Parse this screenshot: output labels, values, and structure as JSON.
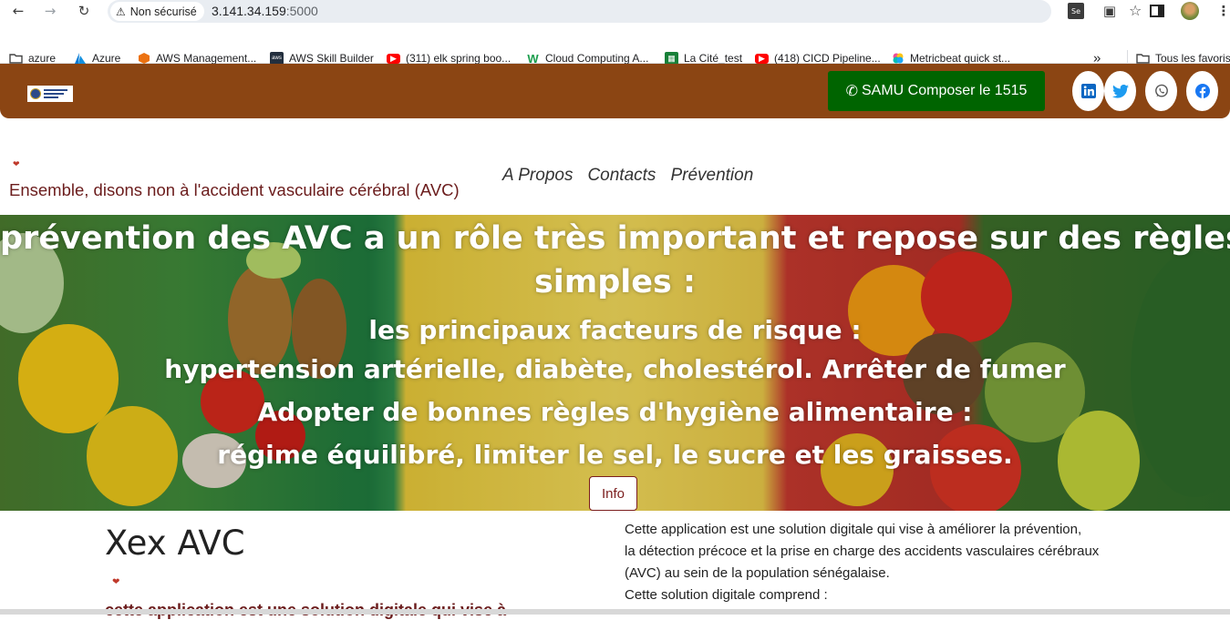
{
  "browser": {
    "security_label": "Non sécurisé",
    "url_host": "3.141.34.159",
    "url_port": ":5000",
    "bookmarks": [
      {
        "label": "azure",
        "icon": "folder-icon"
      },
      {
        "label": "Azure",
        "icon": "azure-icon"
      },
      {
        "label": "AWS Management...",
        "icon": "aws-cube-icon"
      },
      {
        "label": "AWS Skill Builder",
        "icon": "aws-icon"
      },
      {
        "label": "(311) elk spring boo...",
        "icon": "youtube-icon"
      },
      {
        "label": "Cloud Computing A...",
        "icon": "w-icon"
      },
      {
        "label": "La Cité_test",
        "icon": "sheet-icon"
      },
      {
        "label": "(418) CICD Pipeline...",
        "icon": "youtube-icon"
      },
      {
        "label": "Metricbeat quick st...",
        "icon": "elastic-icon"
      }
    ],
    "overflow_label": "»",
    "all_bookmarks_label": "Tous les favoris"
  },
  "header": {
    "samu_label": "SAMU Composer le 1515",
    "social": [
      "linkedin-icon",
      "twitter-icon",
      "whatsapp-icon",
      "facebook-icon"
    ]
  },
  "nav": {
    "brand": "Ensemble, disons non à l'accident vasculaire cérébral (AVC)",
    "links": [
      "A Propos",
      "Contacts",
      "Prévention"
    ]
  },
  "hero": {
    "line1": "prévention des AVC a un rôle très important et repose sur des règles",
    "line2": "simples :",
    "line3": "les principaux facteurs de risque :",
    "line4": "hypertension artérielle, diabète, cholestérol. Arrêter de fumer",
    "line5": "Adopter de bonnes règles d'hygiène alimentaire :",
    "line6": "régime équilibré, limiter le sel, le sucre et les graisses.",
    "info_button": "Info"
  },
  "content": {
    "title": "Xex AVC",
    "cut_text": "cette application est une solution digitale qui vise à",
    "desc_line1": "Cette application est une solution digitale qui vise à améliorer la prévention,",
    "desc_line2": "la détection précoce et la prise en charge des accidents vasculaires cérébraux",
    "desc_line3": "(AVC) au sein de la population sénégalaise.",
    "desc_line4": "Cette solution digitale comprend :"
  }
}
